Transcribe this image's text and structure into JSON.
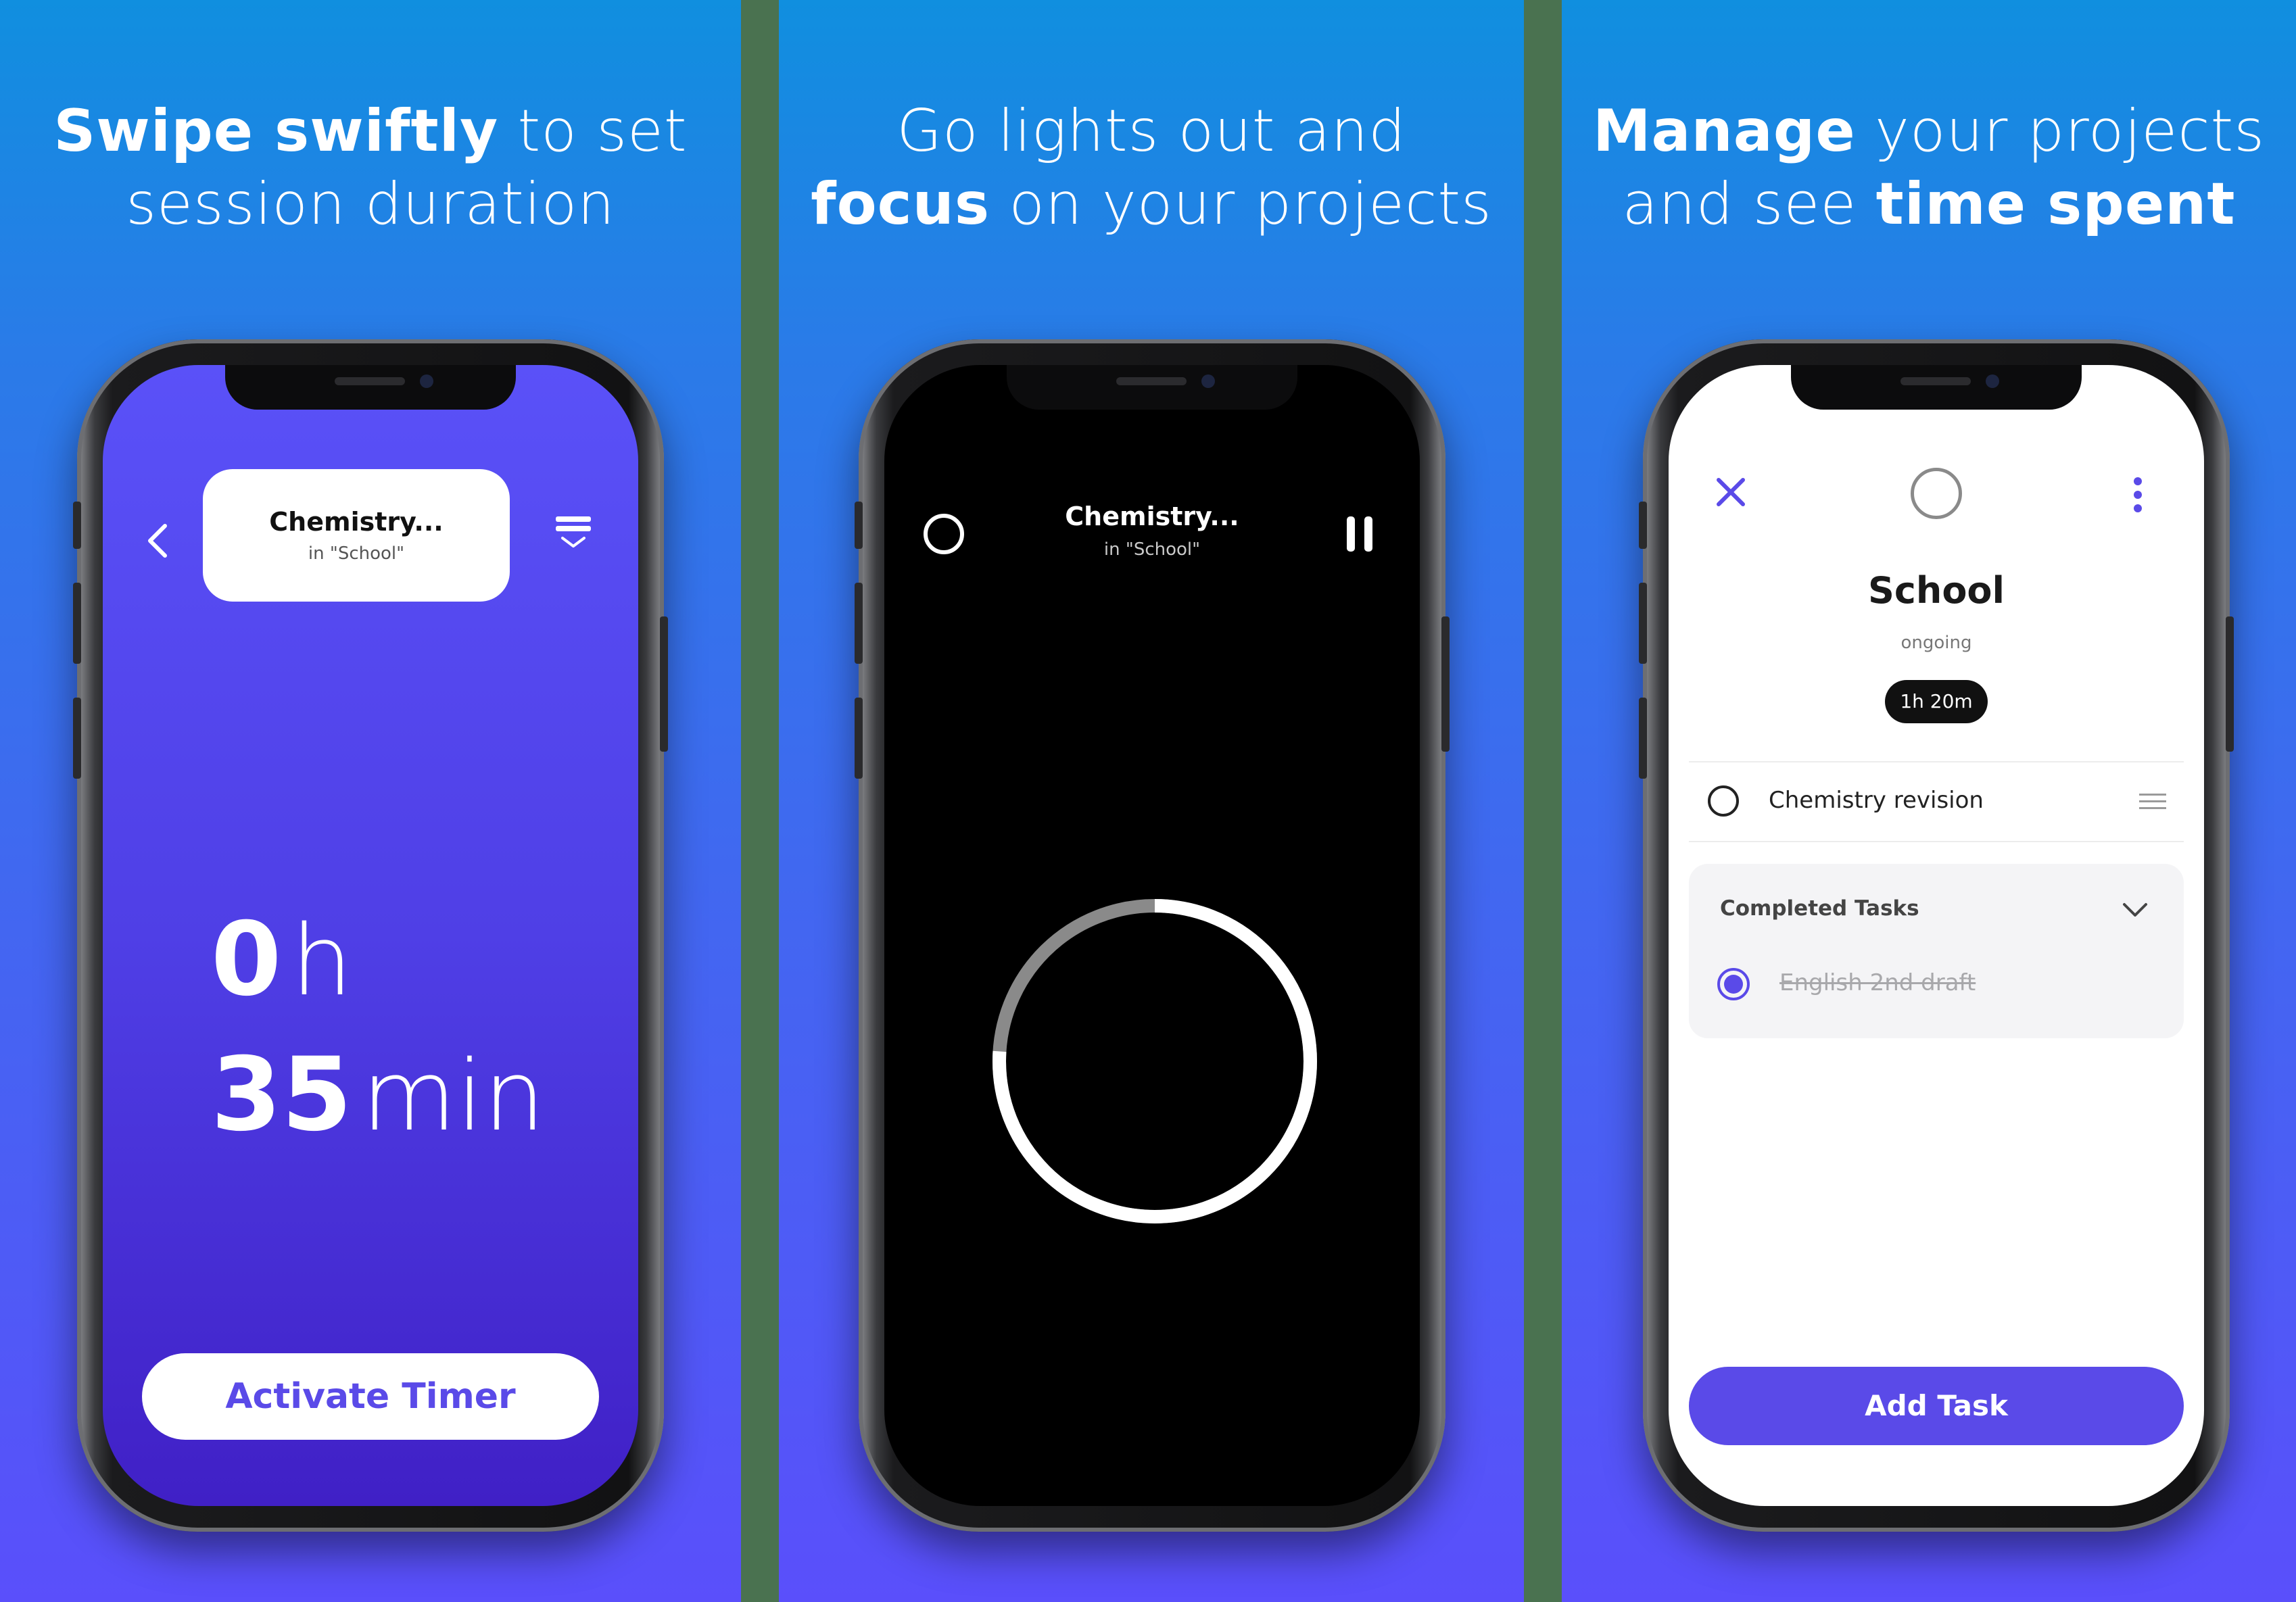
{
  "panels": [
    {
      "headline": {
        "bold1": "Swipe swiftly",
        "rest1": " to set",
        "line2": "session duration"
      },
      "screen": {
        "project_title": "Chemistry...",
        "project_sub": "in \"School\"",
        "hours_value": "0",
        "hours_unit": "h",
        "minutes_value": "35",
        "minutes_unit": "min",
        "button_label": "Activate Timer"
      }
    },
    {
      "headline": {
        "line1": "Go lights out and",
        "bold2": "focus",
        "rest2": " on your projects"
      },
      "screen": {
        "project_title": "Chemistry...",
        "project_sub": "in \"School\"",
        "progress_fraction": 0.76
      }
    },
    {
      "headline": {
        "bold1": "Manage",
        "rest1": " your projects",
        "pre2": "and see ",
        "bold2": "time spent"
      },
      "screen": {
        "project_name": "School",
        "status": "ongoing",
        "time_spent": "1h 20m",
        "tasks": [
          {
            "label": "Chemistry revision"
          }
        ],
        "completed_header": "Completed Tasks",
        "completed_tasks": [
          {
            "label": "English 2nd draft"
          }
        ],
        "button_label": "Add Task"
      }
    }
  ],
  "colors": {
    "accent": "#5a4ae8",
    "panel_gradient_top": "#108fdf",
    "panel_gradient_bottom": "#5a4ffb",
    "separator": "#4a7250"
  }
}
